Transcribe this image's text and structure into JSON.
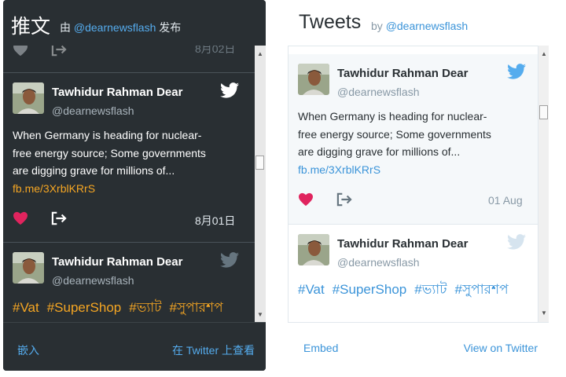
{
  "dark_widget": {
    "title": "推文",
    "by_prefix": "由",
    "handle": "@dearnewsflash",
    "by_suffix": "发布",
    "partial_date": "8月02日",
    "tweets": [
      {
        "name": "Tawhidur Rahman Dear",
        "screen_name": "@dearnewsflash",
        "text": "When Germany is heading for nuclear-free energy source; Some governments are digging grave for millions of...",
        "link": "fb.me/3XrblKRrS",
        "date": "8月01日"
      },
      {
        "name": "Tawhidur Rahman Dear",
        "screen_name": "@dearnewsflash",
        "hashtags": [
          "#Vat",
          "#SuperShop",
          "#ভ্যাট",
          "#সুপারশপ"
        ]
      }
    ],
    "footer": {
      "embed": "嵌入",
      "view": "在 Twitter 上查看"
    }
  },
  "light_widget": {
    "title": "Tweets",
    "by_prefix": "by",
    "handle": "@dearnewsflash",
    "tweets": [
      {
        "name": "Tawhidur Rahman Dear",
        "screen_name": "@dearnewsflash",
        "text": "When Germany is heading for nuclear-free energy source; Some governments are digging grave for millions of...",
        "link": "fb.me/3XrblKRrS",
        "date": "01 Aug"
      },
      {
        "name": "Tawhidur Rahman Dear",
        "screen_name": "@dearnewsflash",
        "hashtags": [
          "#Vat",
          "#SuperShop",
          "#ভ্যাট",
          "#সুপারশপ"
        ]
      }
    ],
    "footer": {
      "embed": "Embed",
      "view": "View on Twitter"
    }
  },
  "icons": {
    "heart": "heart-icon",
    "share": "share-icon",
    "bird": "twitter-bird-icon"
  },
  "colors": {
    "accent_blue": "#55acee",
    "link_orange": "#f5a623",
    "heart_red": "#e0245e",
    "dark_bg": "#292f33"
  }
}
